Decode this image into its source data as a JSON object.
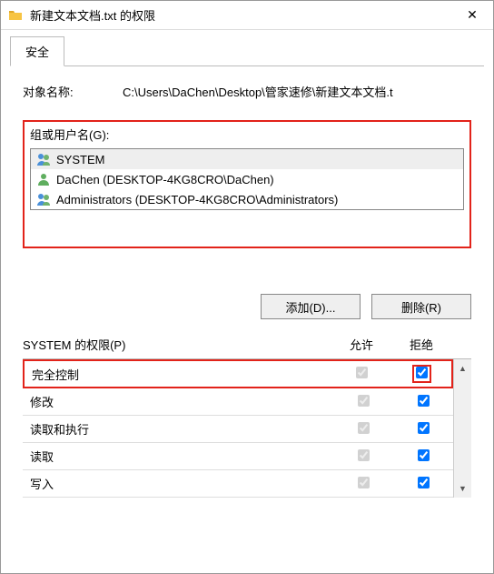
{
  "window": {
    "title": "新建文本文档.txt 的权限",
    "close_glyph": "✕"
  },
  "tab": {
    "security": "安全"
  },
  "object": {
    "label": "对象名称:",
    "path": "C:\\Users\\DaChen\\Desktop\\管家速修\\新建文本文档.t"
  },
  "group_label": "组或用户名(G):",
  "principals": [
    {
      "name": "SYSTEM",
      "icon": "group"
    },
    {
      "name": "DaChen (DESKTOP-4KG8CRO\\DaChen)",
      "icon": "user"
    },
    {
      "name": "Administrators (DESKTOP-4KG8CRO\\Administrators)",
      "icon": "group"
    }
  ],
  "buttons": {
    "add": "添加(D)...",
    "remove": "删除(R)"
  },
  "perm_header": {
    "left": "SYSTEM 的权限(P)",
    "allow": "允许",
    "deny": "拒绝"
  },
  "permissions": [
    {
      "label": "完全控制",
      "allow": true,
      "deny": true,
      "highlight": true
    },
    {
      "label": "修改",
      "allow": true,
      "deny": true
    },
    {
      "label": "读取和执行",
      "allow": true,
      "deny": true
    },
    {
      "label": "读取",
      "allow": true,
      "deny": true
    },
    {
      "label": "写入",
      "allow": true,
      "deny": true
    }
  ]
}
